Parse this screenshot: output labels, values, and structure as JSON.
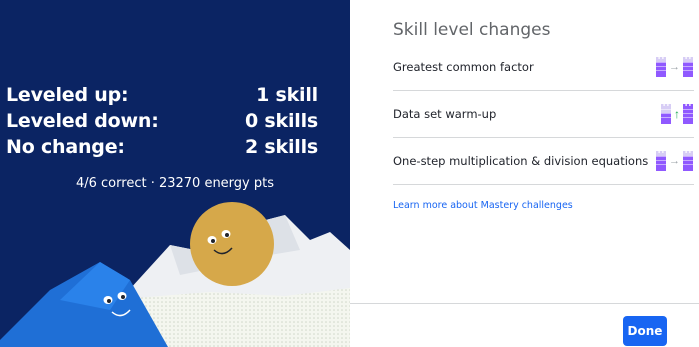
{
  "summary": {
    "leveled_up_label": "Leveled up:",
    "leveled_up_value": "1 skill",
    "leveled_down_label": "Leveled down:",
    "leveled_down_value": "0 skills",
    "no_change_label": "No change:",
    "no_change_value": "2 skills",
    "score_text": "4/6 correct · 23270 energy pts"
  },
  "skill_changes": {
    "title": "Skill level changes",
    "skills": [
      {
        "name": "Greatest common factor",
        "change": "no-change",
        "icon": "right-arrow"
      },
      {
        "name": "Data set warm-up",
        "change": "leveled-up",
        "icon": "up-arrow"
      },
      {
        "name": "One-step multiplication & division equations",
        "change": "no-change",
        "icon": "right-arrow"
      }
    ],
    "learn_more_link": "Learn more about Mastery challenges"
  },
  "footer": {
    "done_label": "Done"
  },
  "colors": {
    "panel_bg": "#0b2463",
    "accent_blue": "#1865f2",
    "level_purple": "#9059ff",
    "up_green": "#1fab54"
  }
}
